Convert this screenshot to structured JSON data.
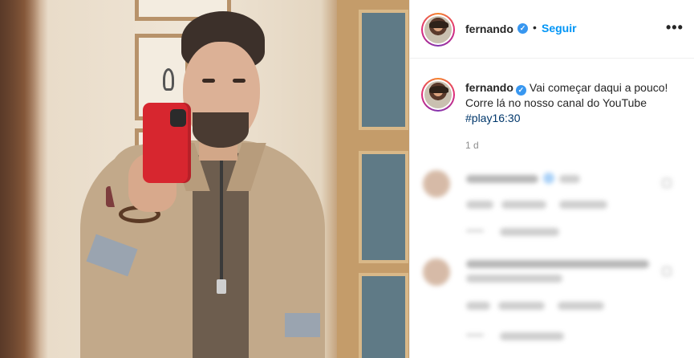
{
  "post": {
    "author": {
      "username": "fernando",
      "verified": true
    },
    "header": {
      "separator": "•",
      "follow_label": "Seguir",
      "more_icon": "more-horizontal-icon",
      "more_label": "•••"
    },
    "caption": {
      "username": "fernando",
      "text": "Vai começar daqui a pouco! Corre lá no nosso canal do YouTube ",
      "hashtag": "#play16:30"
    },
    "timestamp": "1 d"
  },
  "colors": {
    "follow_blue": "#0095f6",
    "verified_blue": "#3897f0",
    "hashtag": "#00376b",
    "muted_text": "#8e8e8e",
    "phone_red": "#d7262f"
  },
  "icons": {
    "verified": "✓"
  }
}
